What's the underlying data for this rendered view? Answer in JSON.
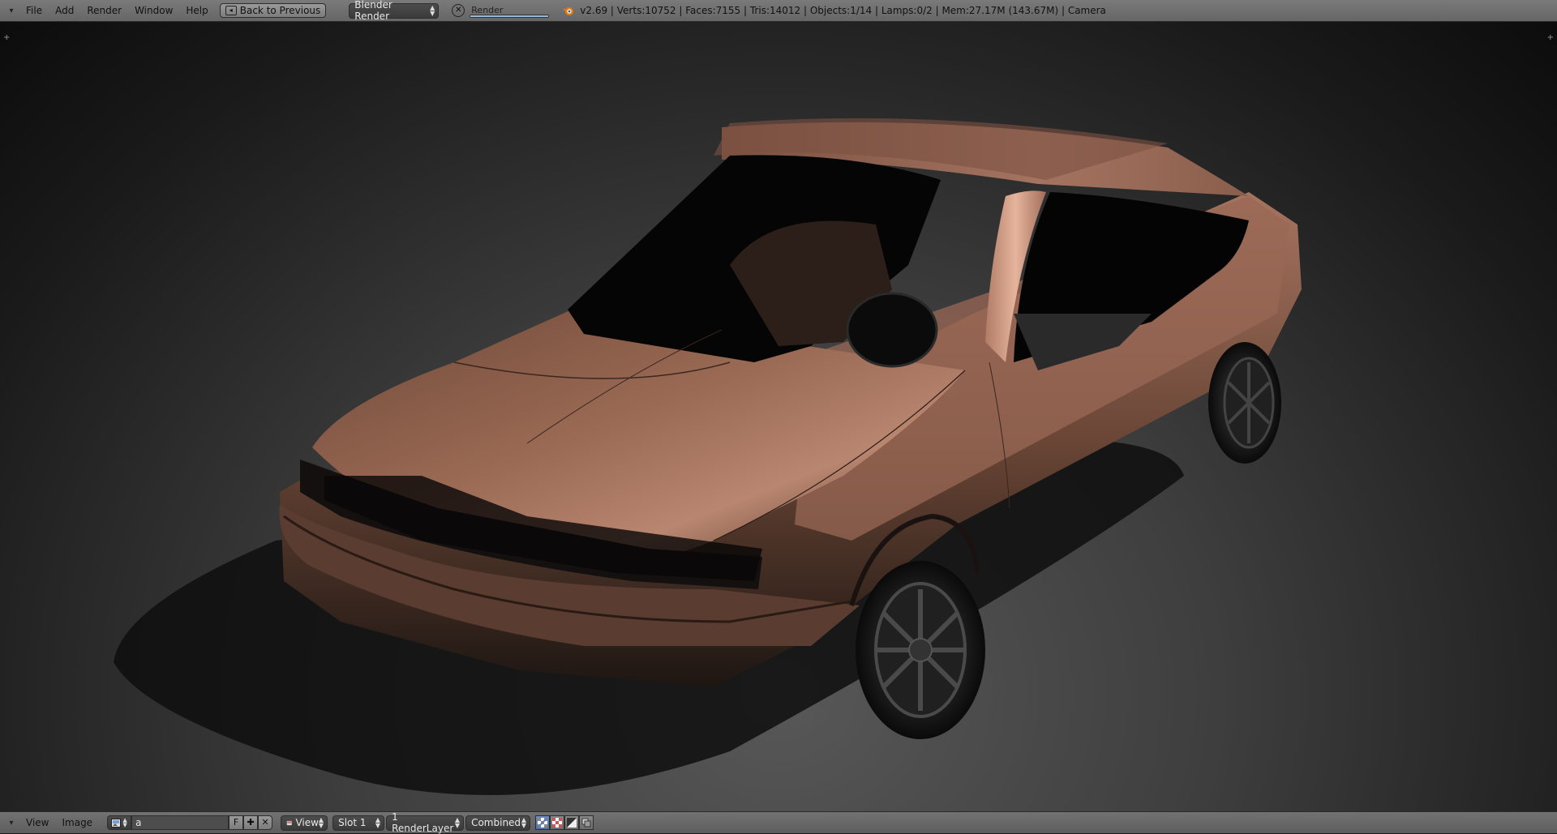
{
  "topbar": {
    "menus": [
      "File",
      "Add",
      "Render",
      "Window",
      "Help"
    ],
    "back_label": "Back to Previous",
    "engine": "Blender Render",
    "progress_label": "Render",
    "progress_fraction": 1.0,
    "stats": "v2.69 | Verts:10752 | Faces:7155 | Tris:14012 | Objects:1/14 | Lamps:0/2 | Mem:27.17M (143.67M) | Camera"
  },
  "bottombar": {
    "menus": [
      "View",
      "Image"
    ],
    "image_name": "a",
    "fake_user_label": "F",
    "view_label": "View",
    "slot": "Slot 1",
    "render_layer": "1 RenderLayer",
    "render_pass": "Combined"
  },
  "colors": {
    "car_body": "#8a5a46",
    "highlight": "#c08a70",
    "accent_blue": "#5a7fbf"
  },
  "icons": {
    "area_toggle": "area-menu-icon",
    "back": "back-arrow-icon",
    "cancel": "cancel-icon",
    "logo": "blender-logo-icon",
    "image_browse": "image-browse-icon",
    "new_image": "plus-icon",
    "unlink": "close-icon",
    "view_icon": "image-editor-icon",
    "draw_rgb_alpha": "checker-alpha-icon",
    "draw_alpha": "checker-icon",
    "draw_zbuffer": "gradient-icon",
    "draw_channels": "channels-icon"
  }
}
